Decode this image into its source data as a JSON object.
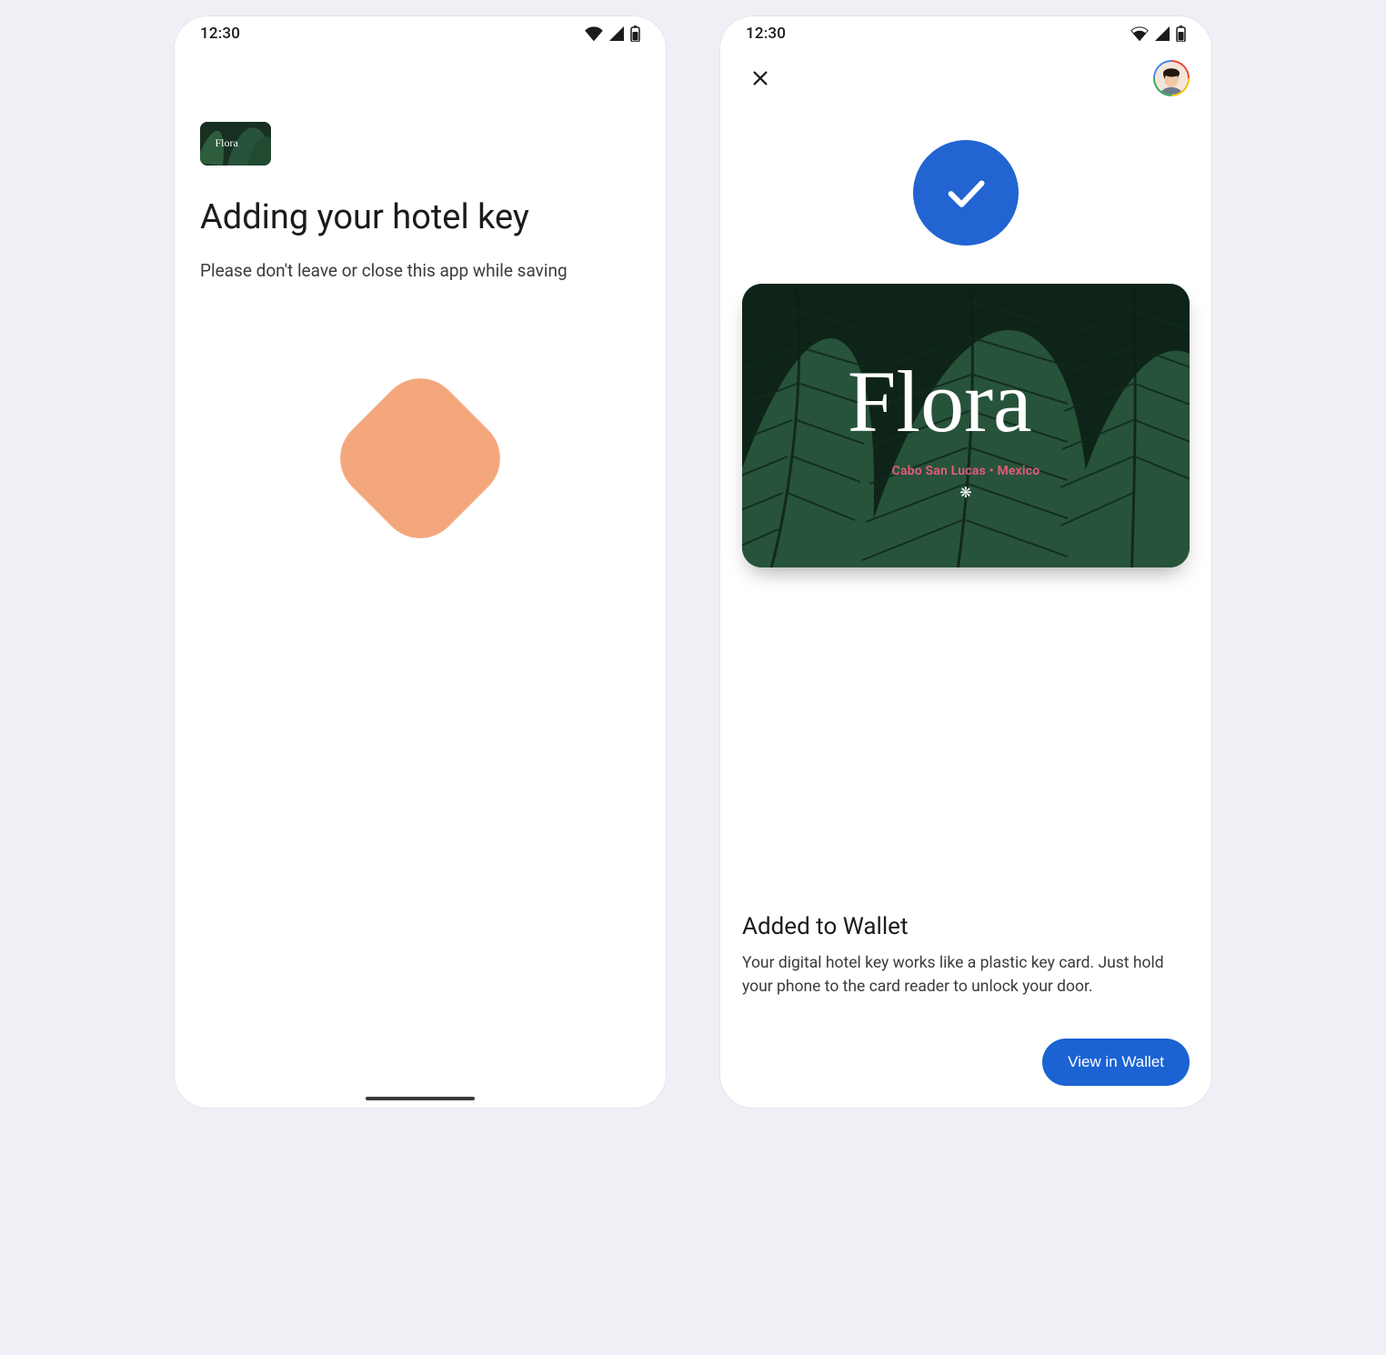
{
  "status": {
    "time": "12:30"
  },
  "left": {
    "brand": "Flora",
    "title": "Adding your hotel key",
    "subtitle": "Please don't leave or close this app while saving"
  },
  "right": {
    "card": {
      "brand": "Flora",
      "location": "Cabo San Lucas  •  Mexico"
    },
    "result_title": "Added to Wallet",
    "result_body": "Your digital hotel key works like a plastic key card. Just hold your phone to the card reader to unlock your door.",
    "cta": "View in Wallet"
  }
}
